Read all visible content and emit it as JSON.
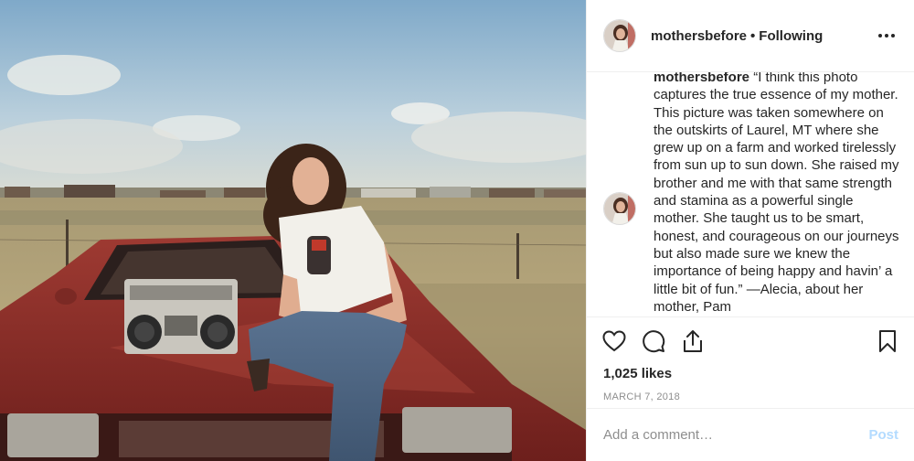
{
  "post": {
    "photo_alt": "",
    "username": "mothersbefore",
    "separator": "•",
    "follow_status": "Following",
    "caption_user": "mothersbefore",
    "caption_text": " “I think this photo captures the true essence of my mother. This picture was taken somewhere on the outskirts of Laurel, MT where she grew up on a farm and worked tirelessly from sun up to sun down. She raised my brother and me with that same strength and stamina as a powerful single mother. She taught us to be smart, honest, and courageous on our journeys but also made sure we knew the importance of being happy and havin’ a little bit of fun.” —Alecia, about her mother, Pam",
    "likes": "1,025 likes",
    "date": "MARCH 7, 2018"
  },
  "comment_box": {
    "placeholder": "Add a comment…",
    "post_label": "Post"
  },
  "icons": {
    "like": "heart-icon",
    "comment": "comment-icon",
    "share": "share-icon",
    "save": "bookmark-icon",
    "more": "more-options-icon"
  },
  "colors": {
    "text": "#262626",
    "muted": "#8e8e8e",
    "post_disabled": "#b3dbff",
    "divider": "#efefef"
  }
}
